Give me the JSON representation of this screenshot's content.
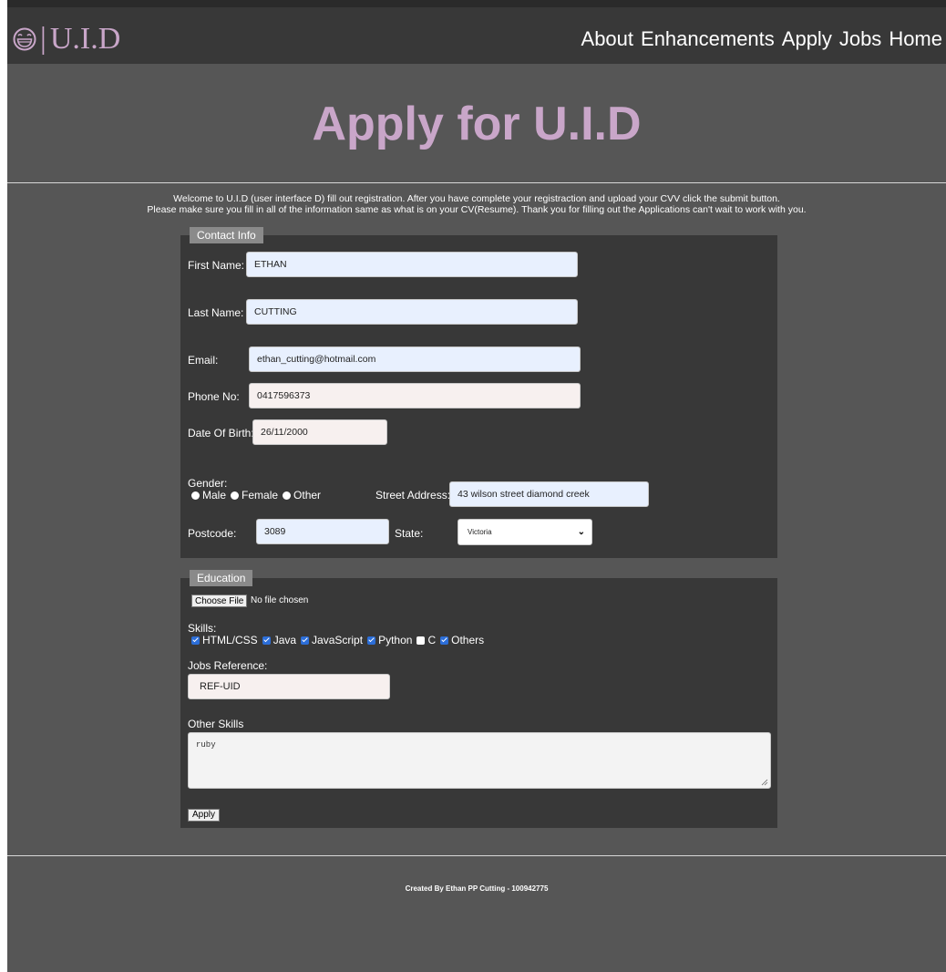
{
  "header": {
    "logo_text": "U.I.D",
    "nav": [
      "About",
      "Enhancements",
      "Apply",
      "Jobs",
      "Home"
    ]
  },
  "hero": {
    "title": "Apply for U.I.D"
  },
  "intro": {
    "line1": "Welcome to U.I.D (user interface D) fill out registration. After you have complete your registraction and upload your CVV click the submit button.",
    "line2": "Please make sure you fill in all of the information same as what is on your CV(Resume). Thank you for filling out the Applications can't wait to work with you."
  },
  "contact": {
    "legend": "Contact Info",
    "first_name_label": "First Name:",
    "first_name_value": "ETHAN",
    "last_name_label": "Last Name:",
    "last_name_value": "CUTTING",
    "email_label": "Email:",
    "email_value": "ethan_cutting@hotmail.com",
    "phone_label": "Phone No:",
    "phone_value": "0417596373",
    "dob_label": "Date Of Birth:",
    "dob_value": "26/11/2000",
    "gender_label": "Gender:",
    "gender_options": [
      "Male",
      "Female",
      "Other"
    ],
    "street_label": "Street Address:",
    "street_value": "43 wilson street diamond creek",
    "postcode_label": "Postcode:",
    "postcode_value": "3089",
    "state_label": "State:",
    "state_value": "Victoria"
  },
  "education": {
    "legend": "Education",
    "file_button": "Choose File",
    "file_status": "No file chosen",
    "skills_label": "Skills:",
    "skills": [
      {
        "label": "HTML/CSS",
        "checked": true
      },
      {
        "label": "Java",
        "checked": true
      },
      {
        "label": "JavaScript",
        "checked": true
      },
      {
        "label": "Python",
        "checked": true
      },
      {
        "label": "C",
        "checked": false
      },
      {
        "label": "Others",
        "checked": true
      }
    ],
    "jobs_ref_label": "Jobs Reference:",
    "jobs_ref_value": "REF-UID",
    "other_skills_label": "Other Skills",
    "other_skills_value": "ruby",
    "apply_button": "Apply"
  },
  "footer": {
    "text": "Created By Ethan PP Cutting - 100942775"
  },
  "colors": {
    "accent": "#c9a6c9",
    "navbar": "#383838",
    "page": "#565656",
    "panel": "#383838"
  }
}
